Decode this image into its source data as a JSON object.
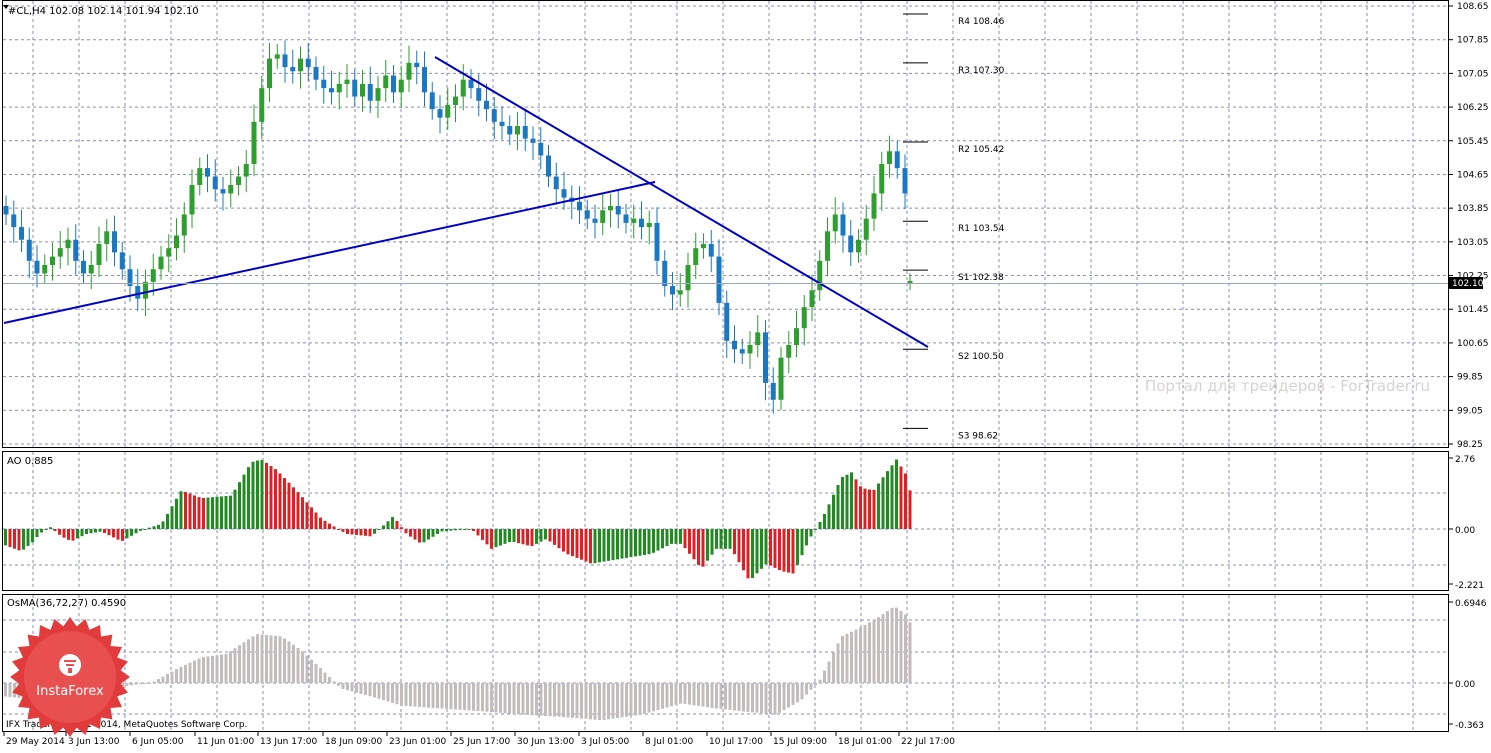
{
  "header": {
    "symbol_line": "#CL,H4  102.08 102.14 101.94 102.10"
  },
  "price_axis": {
    "ticks": [
      "108.65",
      "107.85",
      "107.05",
      "106.25",
      "105.45",
      "104.65",
      "103.85",
      "103.05",
      "102.25",
      "101.45",
      "100.65",
      "99.85",
      "99.05",
      "98.25"
    ],
    "current_price": "102.10"
  },
  "pivots": [
    {
      "label": "R4 108.46",
      "value": 108.46
    },
    {
      "label": "R3 107.30",
      "value": 107.3
    },
    {
      "label": "R2 105.42",
      "value": 105.42
    },
    {
      "label": "R1 103.54",
      "value": 103.54
    },
    {
      "label": "S1 102.38",
      "value": 102.38
    },
    {
      "label": "S2 100.50",
      "value": 100.5
    },
    {
      "label": "S3 98.62",
      "value": 98.62
    }
  ],
  "watermark": "Портал для трейдеров - ForTrader.ru",
  "ao": {
    "label": "AO 0.885",
    "ticks": [
      "2.76",
      "0.00",
      "-2.221"
    ]
  },
  "osma": {
    "label": "OsMA(36,72,27) 0.4590",
    "ticks": [
      "0.6946",
      "0.00",
      "-0.363"
    ]
  },
  "copyright": "IFX Trader, © 2001-2014, MetaQuotes Software Corp.",
  "logo_text": "InstaForex",
  "time_axis": [
    "29 May 2014",
    "3 Jun 13:00",
    "6 Jun 05:00",
    "11 Jun 01:00",
    "13 Jun 17:00",
    "18 Jun 09:00",
    "23 Jun 01:00",
    "25 Jun 17:00",
    "30 Jun 13:00",
    "3 Jul 05:00",
    "8 Jul 01:00",
    "10 Jul 17:00",
    "15 Jul 09:00",
    "18 Jul 01:00",
    "22 Jul 17:00"
  ],
  "colors": {
    "bull": "#2e9e2e",
    "bear": "#1a78c2",
    "ao_up": "#1e8c1e",
    "ao_down": "#e02020",
    "osma": "#c3bcbc",
    "trendline": "#0000c8",
    "grid": "#8c8cb4",
    "logo": "#e23b3b"
  },
  "chart_data": {
    "type": "candlestick",
    "title": "#CL,H4",
    "ohlc_last": {
      "open": 102.08,
      "high": 102.14,
      "low": 101.94,
      "close": 102.1
    },
    "closes": [
      103.7,
      103.4,
      103.1,
      102.6,
      102.3,
      102.5,
      102.7,
      102.9,
      103.1,
      102.6,
      102.3,
      102.5,
      103.0,
      103.3,
      102.8,
      102.4,
      102.0,
      101.7,
      102.1,
      102.4,
      102.7,
      102.9,
      103.2,
      103.7,
      104.4,
      104.8,
      104.6,
      104.3,
      104.2,
      104.4,
      104.6,
      104.9,
      105.9,
      106.7,
      107.4,
      107.5,
      107.2,
      107.1,
      107.4,
      107.2,
      106.9,
      106.7,
      106.6,
      106.8,
      106.9,
      106.5,
      106.8,
      106.4,
      106.7,
      107.0,
      106.6,
      106.9,
      107.3,
      107.2,
      106.6,
      106.2,
      106.0,
      106.3,
      106.5,
      106.9,
      106.7,
      106.4,
      106.2,
      105.9,
      105.8,
      105.6,
      105.8,
      105.5,
      105.4,
      105.1,
      104.6,
      104.3,
      104.1,
      104.0,
      103.8,
      103.6,
      103.5,
      103.8,
      103.9,
      103.7,
      103.5,
      103.6,
      103.4,
      103.5,
      102.6,
      102.0,
      101.8,
      101.9,
      102.5,
      102.9,
      103.0,
      102.7,
      101.6,
      100.7,
      100.5,
      100.4,
      100.6,
      100.9,
      99.7,
      99.3,
      100.3,
      100.6,
      101.0,
      101.5,
      101.9,
      102.6,
      103.3,
      103.7,
      103.2,
      102.8,
      103.1,
      103.6,
      104.2,
      104.9,
      105.2,
      104.8,
      104.2
    ]
  }
}
